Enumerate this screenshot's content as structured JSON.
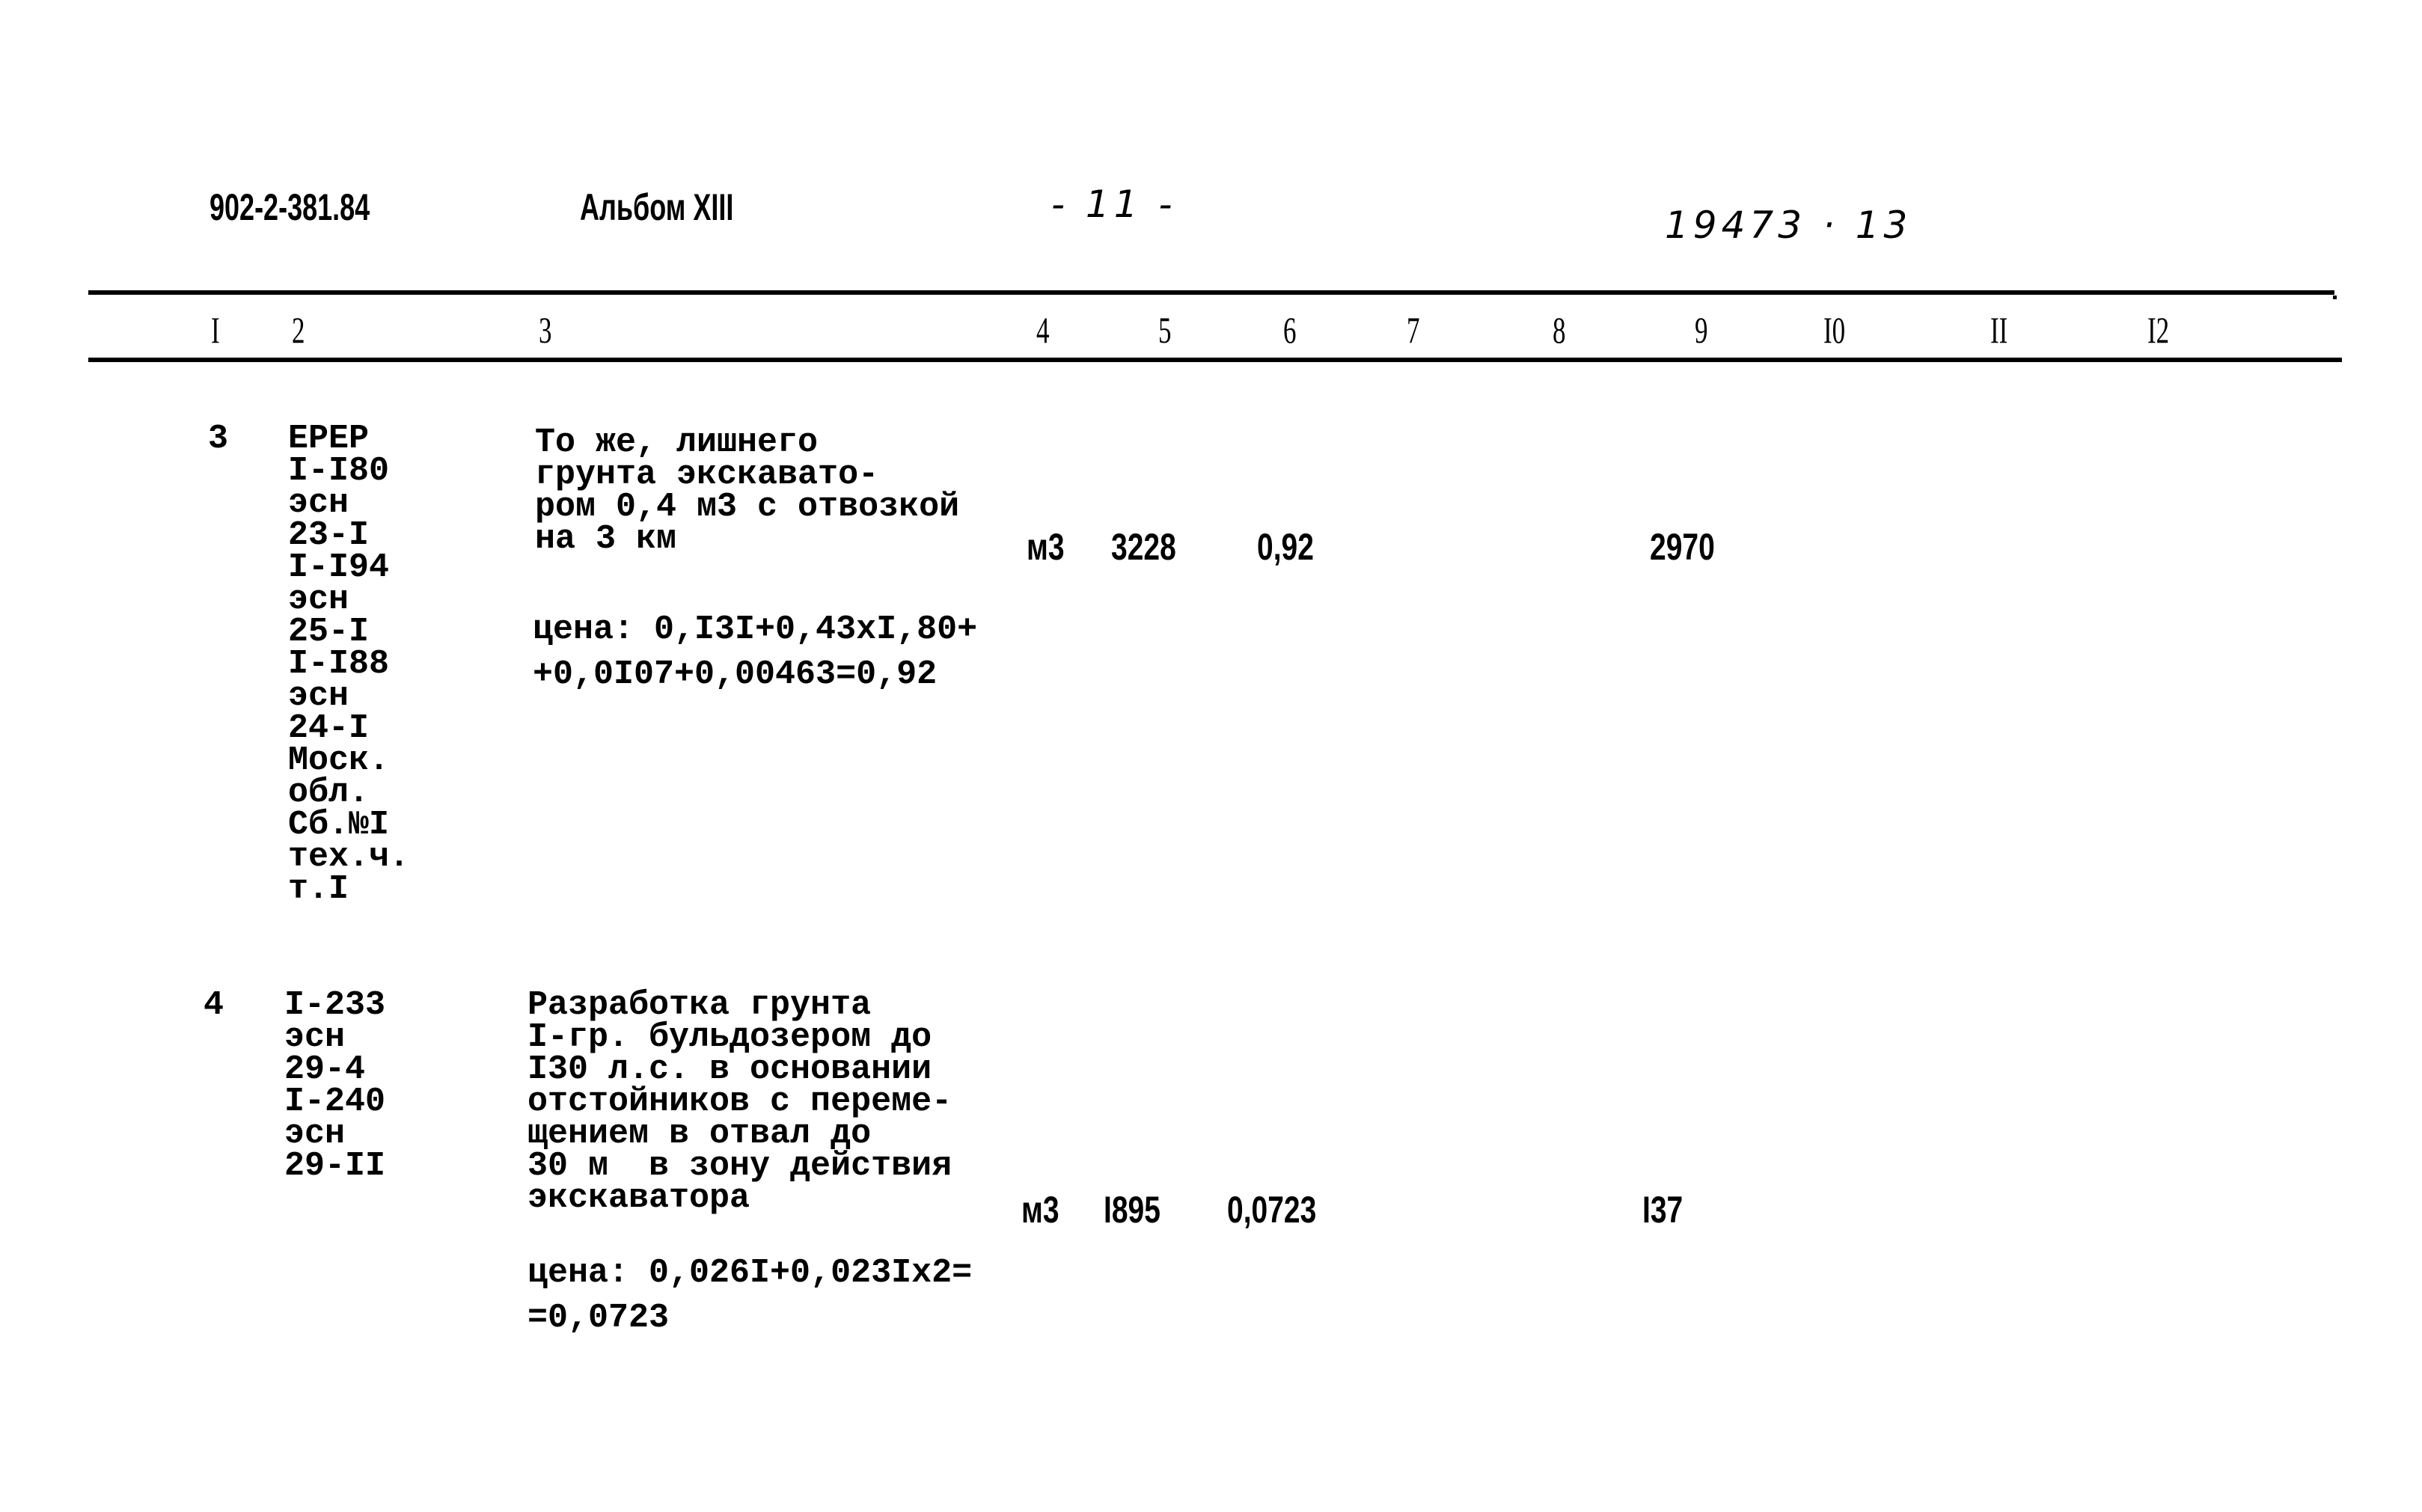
{
  "header": {
    "doc_code": "902-2-381.84",
    "album": "Альбом XIII",
    "page_number": "- 11 -",
    "handwritten_number": "19473 · 13"
  },
  "columns": [
    "I",
    "2",
    "3",
    "4",
    "5",
    "6",
    "7",
    "8",
    "9",
    "I0",
    "II",
    "I2"
  ],
  "rows": [
    {
      "num": "3",
      "codes": [
        "ЕРЕР",
        "I-I80",
        "эсн",
        "23-I",
        "I-I94",
        "эсн",
        "25-I",
        "I-I88",
        "эсн",
        "24-I",
        "Моск.",
        "обл.",
        "Сб.№I",
        "тех.ч.",
        "т.I"
      ],
      "description": [
        "То же, лишнего",
        "грунта экскавато-",
        "ром 0,4 м3 с отвозкой",
        "на 3 км"
      ],
      "price_formula": [
        "цена: 0,I3I+0,43xI,80+",
        "+0,0I07+0,00463=0,92"
      ],
      "unit": "м3",
      "quantity": "3228",
      "unit_price": "0,92",
      "col9": "2970"
    },
    {
      "num": "4",
      "codes": [
        "I-233",
        "эсн",
        "29-4",
        "I-240",
        "эсн",
        "29-II"
      ],
      "description": [
        "Разработка грунта",
        "I-гр. бульдозером до",
        "I30 л.с. в основании",
        "отстойников с переме-",
        "щением в отвал до",
        "30 м  в зону действия",
        "экскаватора"
      ],
      "price_formula": [
        "цена: 0,026I+0,023Ix2=",
        "=0,0723"
      ],
      "unit": "м3",
      "quantity": "I895",
      "unit_price": "0,0723",
      "col9": "I37"
    }
  ]
}
